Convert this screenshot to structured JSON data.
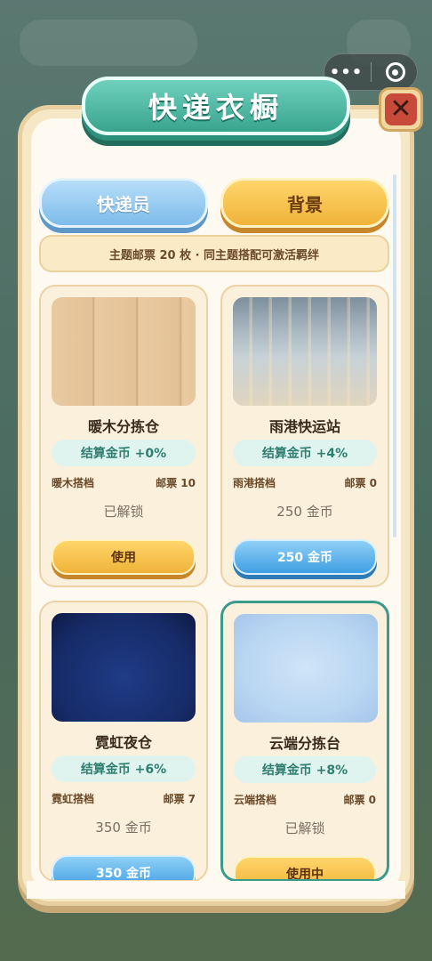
{
  "window": {
    "title": "快递衣橱",
    "close_icon": "close-icon",
    "more_icon": "•••"
  },
  "tabs": [
    {
      "label": "快递员",
      "active": false,
      "color": "#7dbbe9"
    },
    {
      "label": "背景",
      "active": true,
      "color": "#f0b33a"
    }
  ],
  "info_text": "主题邮票 20 枚 · 同主题搭配可激活羁绊",
  "cards": [
    {
      "name": "暖木分拣仓",
      "bonus": "结算金币 +0%",
      "theme": "暖木搭档",
      "stamps": "邮票 10",
      "status": "已解锁",
      "action": "使用",
      "action_style": "gold",
      "selected": false
    },
    {
      "name": "雨港快运站",
      "bonus": "结算金币 +4%",
      "theme": "雨港搭档",
      "stamps": "邮票 0",
      "status": "250 金币",
      "action": "250 金币",
      "action_style": "blue",
      "selected": false
    },
    {
      "name": "霓虹夜仓",
      "bonus": "结算金币 +6%",
      "theme": "霓虹搭档",
      "stamps": "邮票 7",
      "status": "350 金币",
      "action": "350 金币",
      "action_style": "blue",
      "selected": false
    },
    {
      "name": "云端分拣台",
      "bonus": "结算金币 +8%",
      "theme": "云端搭档",
      "stamps": "邮票 0",
      "status": "已解锁",
      "action": "使用中",
      "action_style": "gold",
      "selected": true
    }
  ],
  "colors": {
    "accent_teal": "#39a48e",
    "gold": "#f0b33a",
    "blue": "#3f9ee3",
    "close_red": "#c84a3a"
  }
}
